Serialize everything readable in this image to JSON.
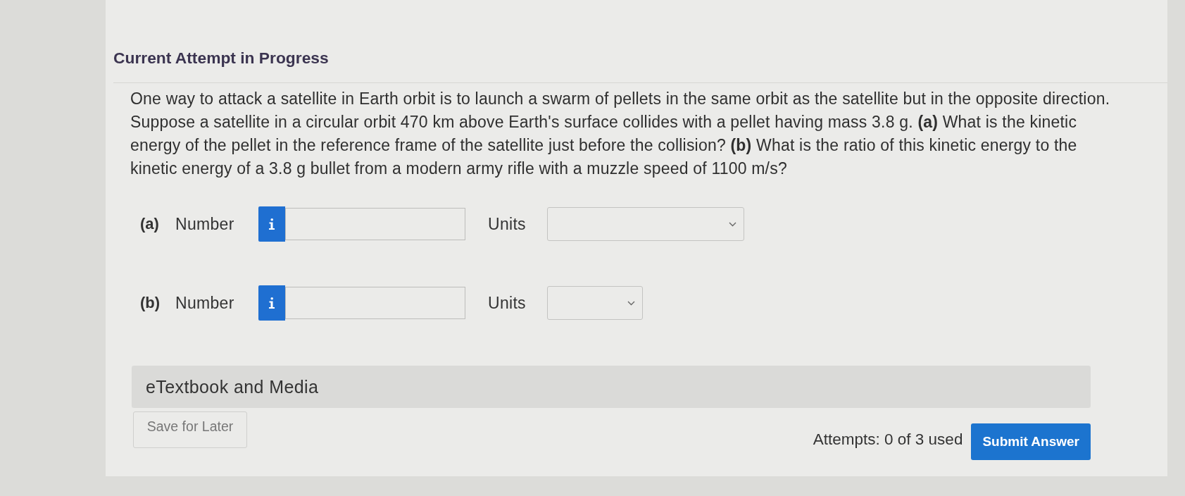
{
  "header": {
    "title": "Current Attempt in Progress"
  },
  "question": {
    "text": "One way to attack a satellite in Earth orbit is to launch a swarm of pellets in the same orbit as the satellite but in the opposite direction. Suppose a satellite in a circular orbit 470 km above Earth's surface collides with a pellet having mass 3.8 g. **(a)** What is the kinetic energy of the pellet in the reference frame of the satellite just before the collision? **(b)** What is the ratio of this kinetic energy to the kinetic energy of a 3.8 g bullet from a modern army rifle with a muzzle speed of 1100 m/s?"
  },
  "answers": [
    {
      "part": "(a)",
      "number_label": "Number",
      "units_label": "Units"
    },
    {
      "part": "(b)",
      "number_label": "Number",
      "units_label": "Units"
    }
  ],
  "resources": {
    "title": "eTextbook and Media"
  },
  "footer": {
    "save_button": "Save for Later",
    "attempts": "Attempts: 0 of 3 used",
    "submit_button": "Submit Answer"
  }
}
